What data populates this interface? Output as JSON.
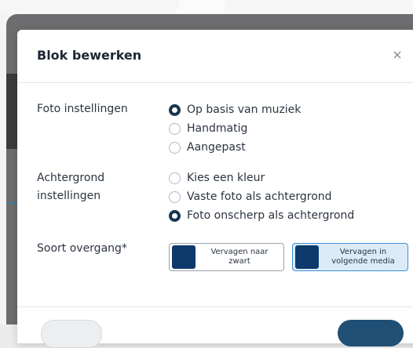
{
  "modal": {
    "title": "Blok bewerken"
  },
  "photo_settings": {
    "label": "Foto instellingen",
    "options": [
      {
        "label": "Op basis van muziek",
        "checked": true
      },
      {
        "label": "Handmatig",
        "checked": false
      },
      {
        "label": "Aangepast",
        "checked": false
      }
    ]
  },
  "background_settings": {
    "label_line1": "Achtergrond",
    "label_line2": "instellingen",
    "options": [
      {
        "label": "Kies een kleur",
        "checked": false
      },
      {
        "label": "Vaste foto als achtergrond",
        "checked": false
      },
      {
        "label": "Foto onscherp als achtergrond",
        "checked": true
      }
    ]
  },
  "transition": {
    "label": "Soort overgang*",
    "options": [
      {
        "line1": "Vervagen naar",
        "line2": "zwart",
        "selected": false
      },
      {
        "line1": "Vervagen in",
        "line2": "volgende media",
        "selected": true
      }
    ]
  },
  "colors": {
    "radio_checked": "#17354f",
    "swatch": "#0d3a6b",
    "selected_border": "#3d8fd6",
    "selected_bg": "#dcebf8"
  },
  "icons": {
    "close": "close-icon"
  }
}
